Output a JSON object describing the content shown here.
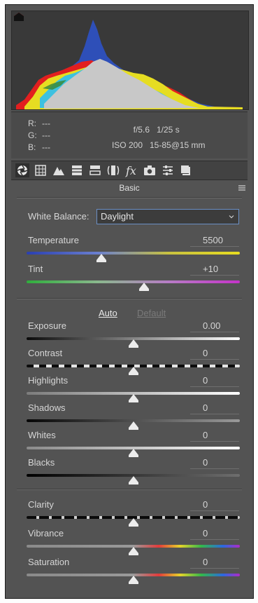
{
  "camera_info": {
    "r_label": "R:",
    "r_value": "---",
    "g_label": "G:",
    "g_value": "---",
    "b_label": "B:",
    "b_value": "---",
    "aperture": "f/5.6",
    "shutter": "1/25 s",
    "iso": "ISO 200",
    "lens": "15-85@15 mm"
  },
  "tabs": [
    "basic-icon",
    "tone-curve-icon",
    "detail-icon",
    "hsl-icon",
    "split-toning-icon",
    "lens-corrections-icon",
    "fx-icon",
    "camera-calibration-icon",
    "presets-icon",
    "snapshots-icon"
  ],
  "panel": {
    "title": "Basic"
  },
  "white_balance": {
    "label": "White Balance:",
    "value": "Daylight"
  },
  "temperature": {
    "label": "Temperature",
    "value": "5500",
    "level": 0.35
  },
  "tint": {
    "label": "Tint",
    "value": "+10",
    "level": 0.55
  },
  "tone": {
    "auto_label": "Auto",
    "default_label": "Default"
  },
  "exposure": {
    "label": "Exposure",
    "value": "0.00",
    "level": 0.5
  },
  "contrast": {
    "label": "Contrast",
    "value": "0",
    "level": 0.5
  },
  "highlights": {
    "label": "Highlights",
    "value": "0",
    "level": 0.5
  },
  "shadows": {
    "label": "Shadows",
    "value": "0",
    "level": 0.5
  },
  "whites": {
    "label": "Whites",
    "value": "0",
    "level": 0.5
  },
  "blacks": {
    "label": "Blacks",
    "value": "0",
    "level": 0.5
  },
  "clarity": {
    "label": "Clarity",
    "value": "0",
    "level": 0.5
  },
  "vibrance": {
    "label": "Vibrance",
    "value": "0",
    "level": 0.5
  },
  "saturation": {
    "label": "Saturation",
    "value": "0",
    "level": 0.5
  }
}
